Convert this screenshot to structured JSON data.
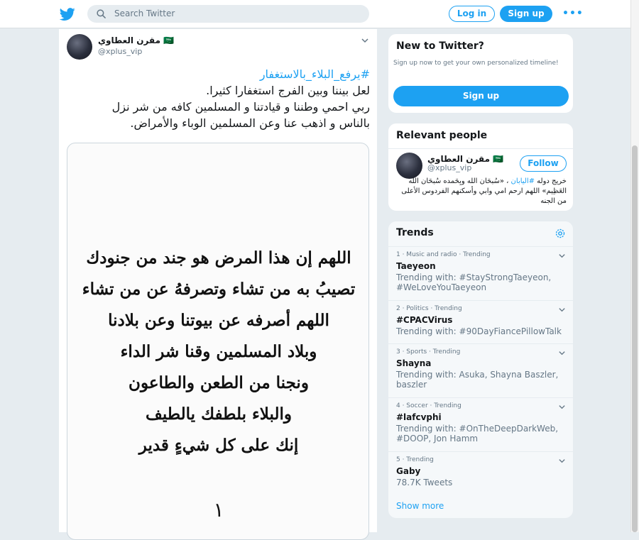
{
  "header": {
    "search_placeholder": "Search Twitter",
    "login_label": "Log in",
    "signup_label": "Sign up",
    "more_label": "•••"
  },
  "tweet": {
    "author_name": "مقرن العطاوي 🇸🇦",
    "author_handle": "@xplus_vip",
    "hashtag": "#يرفع_البلاء_بالاستغفار",
    "lines": [
      "لعل بيننا وبين الفرج استغفارا كثيرا.",
      "ربي احمي وطننا و قيادتنا و المسلمين كافه من شر نزل",
      "بالناس و اذهب عنا وعن المسلمين الوباء والأمراض."
    ],
    "image_lines": [
      "اللهم إن هذا المرض هو جند من جنودك",
      "تصيبُ به من تشاء وتصرفهُ عن من تشاء",
      "اللهم أصرفه عن بيوتنا وعن بلادنا",
      "وبلاد المسلمين وقنا شر الداء",
      "ونجنا من الطعن والطاعون",
      "والبلاء بلطفك يالطيف",
      "إنك على كل شيءٍ قدير"
    ],
    "image_extra": "١"
  },
  "new_to_twitter": {
    "title": "New to Twitter?",
    "description": "Sign up now to get your own personalized timeline!",
    "signup_label": "Sign up"
  },
  "relevant_people": {
    "title": "Relevant people",
    "name": "مقرن العطاوي 🇸🇦",
    "handle": "@xplus_vip",
    "follow_label": "Follow",
    "bio_part1": "خريج دوله ",
    "bio_link": "#اليابان",
    "bio_part2": " ، «سُبحَان الله وبِحَمده سُبحَان الله العَظِيم» اللهم ارحم امي وابي وأسكنهم الفردوس الأعلى من الجنه"
  },
  "trends": {
    "title": "Trends",
    "items": [
      {
        "meta": "1 · Music and radio · Trending",
        "name": "Taeyeon",
        "sub": "Trending with: #StayStrongTaeyeon, #WeLoveYouTaeyeon"
      },
      {
        "meta": "2 · Politics · Trending",
        "name": "#CPACVirus",
        "sub": "Trending with: #90DayFiancePillowTalk"
      },
      {
        "meta": "3 · Sports · Trending",
        "name": "Shayna",
        "sub": "Trending with: Asuka, Shayna Baszler, baszler"
      },
      {
        "meta": "4 · Soccer · Trending",
        "name": "#lafcvphi",
        "sub": "Trending with: #OnTheDeepDarkWeb, #DOOP, Jon Hamm"
      },
      {
        "meta": "5 · Trending",
        "name": "Gaby",
        "sub": "78.7K Tweets"
      }
    ],
    "show_more": "Show more"
  },
  "colors": {
    "accent": "#1da1f2",
    "background": "#e6ecf0",
    "secondary_text": "#657786"
  }
}
